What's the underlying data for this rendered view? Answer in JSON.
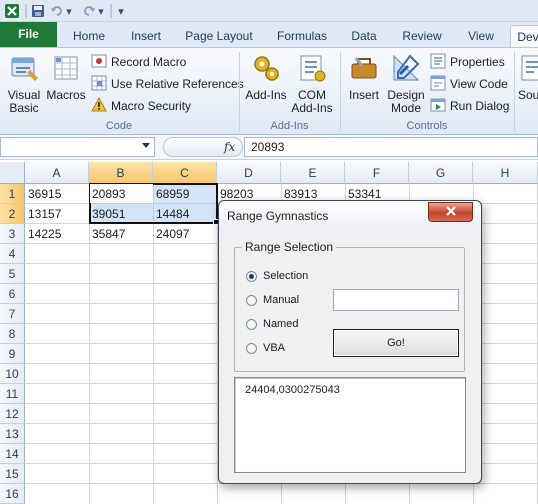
{
  "quick_access": {
    "undo_arrow": "▾",
    "redo_arrow": "▾",
    "customize": "▾"
  },
  "tabs": [
    "File",
    "Home",
    "Insert",
    "Page Layout",
    "Formulas",
    "Data",
    "Review",
    "View",
    "Dev"
  ],
  "ribbon": {
    "code": {
      "label": "Code",
      "visual_basic": "Visual Basic",
      "macros": "Macros",
      "record_macro": "Record Macro",
      "use_relative_references": "Use Relative References",
      "macro_security": "Macro Security"
    },
    "addins": {
      "label": "Add-Ins",
      "add_ins": "Add-Ins",
      "com_add_ins": "COM Add-Ins"
    },
    "controls": {
      "label": "Controls",
      "insert": "Insert",
      "design_mode": "Design Mode",
      "properties": "Properties",
      "view_code": "View Code",
      "run_dialog": "Run Dialog"
    },
    "source": "Sou"
  },
  "formula_bar": {
    "name_box": "",
    "fx": "fx",
    "value": "20893"
  },
  "grid": {
    "columns": [
      "A",
      "B",
      "C",
      "D",
      "E",
      "F",
      "G",
      "H"
    ],
    "rows": [
      "1",
      "2",
      "3",
      "4",
      "5",
      "6",
      "7",
      "8",
      "9",
      "10",
      "11",
      "12",
      "13",
      "14",
      "15",
      "16"
    ],
    "cells": {
      "A1": "36915",
      "B1": "20893",
      "C1": "68959",
      "D1": "98203",
      "E1": "83913",
      "F1": "53341",
      "A2": "13157",
      "B2": "39051",
      "C2": "14484",
      "A3": "14225",
      "B3": "35847",
      "C3": "24097"
    }
  },
  "dialog": {
    "title": "Range Gymnastics",
    "group_label": "Range Selection",
    "options": [
      "Selection",
      "Manual",
      "Named",
      "VBA"
    ],
    "selected_option": "Selection",
    "manual_value": "",
    "go_label": "Go!",
    "result": "24404,0300275043"
  }
}
